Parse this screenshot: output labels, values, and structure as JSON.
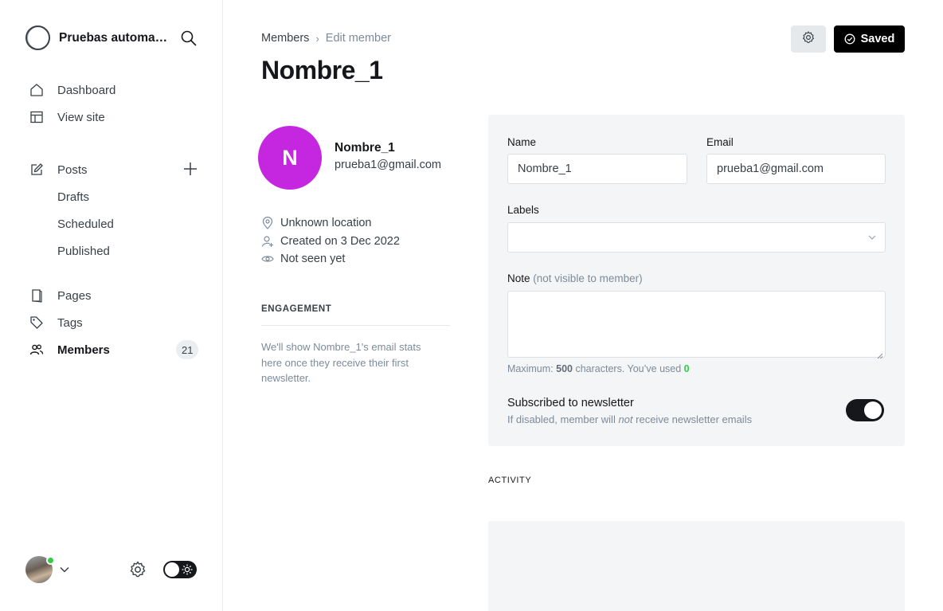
{
  "sidebar": {
    "brand_title": "Pruebas automa…",
    "nav": {
      "dashboard": "Dashboard",
      "view_site": "View site",
      "posts": "Posts",
      "drafts": "Drafts",
      "scheduled": "Scheduled",
      "published": "Published",
      "pages": "Pages",
      "tags": "Tags",
      "members": "Members",
      "members_count": "21"
    }
  },
  "header": {
    "breadcrumb_parent": "Members",
    "breadcrumb_sep": "›",
    "breadcrumb_current": "Edit member",
    "title": "Nombre_1",
    "saved_label": "Saved"
  },
  "member": {
    "initial": "N",
    "avatar_color": "#c526e0",
    "name": "Nombre_1",
    "email": "prueba1@gmail.com",
    "location": "Unknown location",
    "created": "Created on 3 Dec 2022",
    "seen": "Not seen yet"
  },
  "engagement": {
    "heading": "ENGAGEMENT",
    "text": "We'll show Nombre_1's email stats here once they receive their first newsletter."
  },
  "form": {
    "name_label": "Name",
    "name_value": "Nombre_1",
    "email_label": "Email",
    "email_value": "prueba1@gmail.com",
    "labels_label": "Labels",
    "note_label": "Note",
    "note_hint": "(not visible to member)",
    "counter_prefix": "Maximum: ",
    "counter_max": "500",
    "counter_mid": " characters. You’ve used ",
    "counter_used": "0",
    "newsletter_title": "Subscribed to newsletter",
    "newsletter_desc_1": "If disabled, member will ",
    "newsletter_desc_em": "not",
    "newsletter_desc_2": " receive newsletter emails",
    "newsletter_on": true
  },
  "activity": {
    "heading": "ACTIVITY"
  },
  "colors": {
    "accent_green": "#30cf43",
    "primary_black": "#000000"
  }
}
